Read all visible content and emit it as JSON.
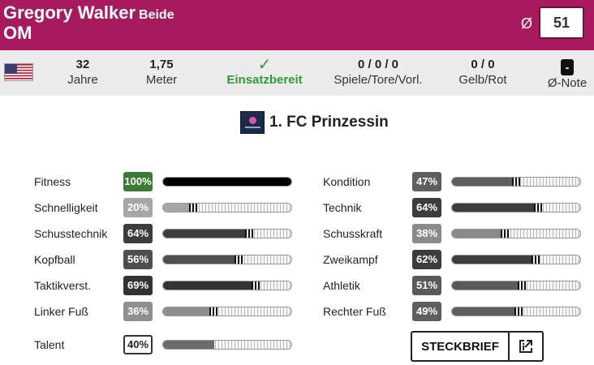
{
  "header": {
    "name": "Gregory Walker",
    "foot": "Beide",
    "position": "OM",
    "avg_symbol": "Ø",
    "avg_value": "51",
    "color": "#a71a5e"
  },
  "info": {
    "flag": "us-flag-icon",
    "age_value": "32",
    "age_label": "Jahre",
    "height_value": "1,75",
    "height_label": "Meter",
    "status_icon": "✓",
    "status_label": "Einsatzbereit",
    "stats_value": "0 / 0 / 0",
    "stats_label": "Spiele/Tore/Vorl.",
    "cards_value": "0 / 0",
    "cards_label": "Gelb/Rot",
    "note_value": "-",
    "note_label": "Ø-Note"
  },
  "club": {
    "name": "1. FC Prinzessin"
  },
  "attributes_left": [
    {
      "label": "Fitness",
      "value": "100%",
      "fraction": 1.0,
      "color": "#3c7a35"
    },
    {
      "label": "Schnelligkeit",
      "value": "20%",
      "fraction": 0.2,
      "color": "#a6a6a6"
    },
    {
      "label": "Schusstechnik",
      "value": "64%",
      "fraction": 0.64,
      "color": "#3d3d3d"
    },
    {
      "label": "Kopfball",
      "value": "56%",
      "fraction": 0.56,
      "color": "#4f4f4f"
    },
    {
      "label": "Taktikverst.",
      "value": "69%",
      "fraction": 0.69,
      "color": "#333333"
    },
    {
      "label": "Linker Fuß",
      "value": "36%",
      "fraction": 0.36,
      "color": "#8f8f8f"
    }
  ],
  "attributes_right": [
    {
      "label": "Kondition",
      "value": "47%",
      "fraction": 0.47,
      "color": "#5e5e5e"
    },
    {
      "label": "Technik",
      "value": "64%",
      "fraction": 0.64,
      "color": "#3d3d3d"
    },
    {
      "label": "Schusskraft",
      "value": "38%",
      "fraction": 0.38,
      "color": "#8a8a8a"
    },
    {
      "label": "Zweikampf",
      "value": "62%",
      "fraction": 0.62,
      "color": "#3d3d3d"
    },
    {
      "label": "Athletik",
      "value": "51%",
      "fraction": 0.51,
      "color": "#5a5a5a"
    },
    {
      "label": "Rechter Fuß",
      "value": "49%",
      "fraction": 0.49,
      "color": "#5e5e5e"
    }
  ],
  "talent": {
    "label": "Talent",
    "value": "40%",
    "fraction": 0.4
  },
  "steckbrief": {
    "label": "STECKBRIEF",
    "icon": "external-link-icon"
  }
}
